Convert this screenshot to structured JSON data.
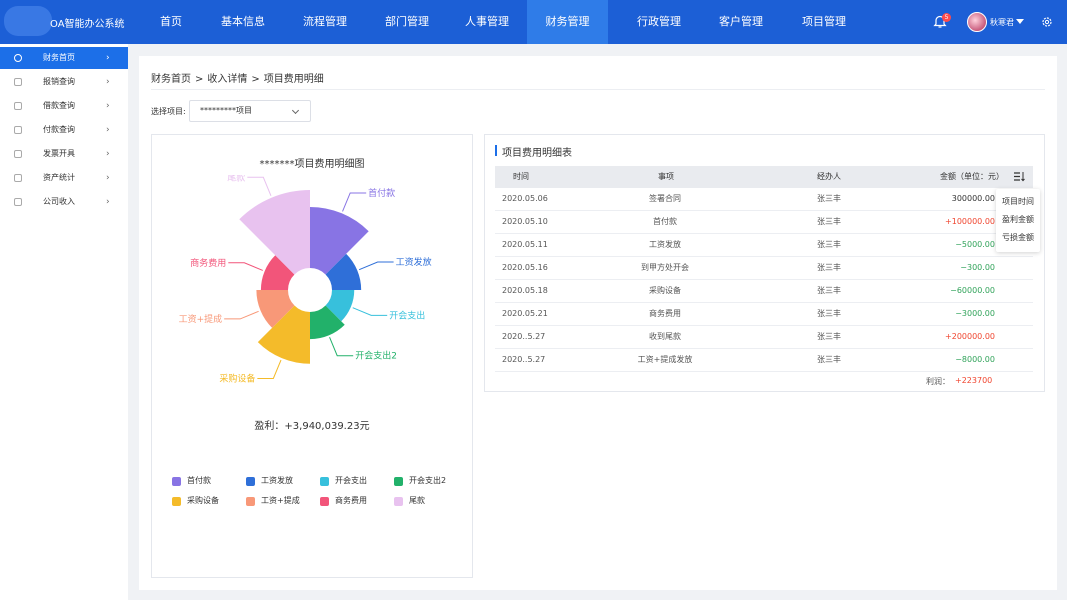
{
  "app": {
    "title": "OA智能办公系统"
  },
  "nav": [
    {
      "label": "首页"
    },
    {
      "label": "基本信息"
    },
    {
      "label": "流程管理"
    },
    {
      "label": "部门管理"
    },
    {
      "label": "人事管理"
    },
    {
      "label": "财务管理",
      "active": true
    },
    {
      "label": "行政管理"
    },
    {
      "label": "客户管理"
    },
    {
      "label": "项目管理"
    }
  ],
  "header": {
    "notifications": "5",
    "user_name": "秋寒君"
  },
  "sidebar": {
    "items": [
      {
        "label": "财务首页",
        "icon": "user-icon",
        "active": true
      },
      {
        "label": "报销查询",
        "icon": "list-icon"
      },
      {
        "label": "借款查询",
        "icon": "home-icon"
      },
      {
        "label": "付款查询",
        "icon": "document-icon"
      },
      {
        "label": "发票开具",
        "icon": "gift-icon"
      },
      {
        "label": "资产统计",
        "icon": "clock-icon"
      },
      {
        "label": "公司收入",
        "icon": "gift-icon"
      }
    ]
  },
  "breadcrumb": [
    "财务首页",
    "收入详情",
    "项目费用明细"
  ],
  "breadcrumb_sep": ">",
  "filter": {
    "label": "选择项目:",
    "value": "*********项目"
  },
  "chart_data": {
    "type": "pie",
    "variant": "nightingale-rose",
    "title": "*******项目费用明细图",
    "categories": [
      "首付款",
      "工资发放",
      "开会支出",
      "开会支出2",
      "采购设备",
      "工资+提成",
      "商务费用",
      "尾款"
    ],
    "values": [
      100000,
      5000,
      300,
      3000,
      60000,
      8000,
      3000,
      200000
    ],
    "colors": [
      "#8874e4",
      "#2f6fd8",
      "#37c0dc",
      "#22b16a",
      "#f4bb2a",
      "#f89878",
      "#f2557a",
      "#e8c2ef"
    ],
    "legend_position": "bottom"
  },
  "profit_text": "盈利：+3,940,039.23元",
  "table": {
    "title": "项目费用明细表",
    "columns": [
      "时间",
      "事项",
      "经办人",
      "金额（单位：元）"
    ],
    "rows": [
      {
        "date": "2020.05.06",
        "item": "签署合同",
        "handler": "张三丰",
        "amount": "300000.00",
        "kind": "base"
      },
      {
        "date": "2020.05.10",
        "item": "首付款",
        "handler": "张三丰",
        "amount": "+100000.00",
        "kind": "pos"
      },
      {
        "date": "2020.05.11",
        "item": "工资发放",
        "handler": "张三丰",
        "amount": "−5000.00",
        "kind": "neg"
      },
      {
        "date": "2020.05.16",
        "item": "到甲方处开会",
        "handler": "张三丰",
        "amount": "−300.00",
        "kind": "neg"
      },
      {
        "date": "2020.05.18",
        "item": "采购设备",
        "handler": "张三丰",
        "amount": "−60000.00",
        "kind": "neg"
      },
      {
        "date": "2020.05.21",
        "item": "商务费用",
        "handler": "张三丰",
        "amount": "−3000.00",
        "kind": "neg"
      },
      {
        "date": "2020..5.27",
        "item": "收到尾款",
        "handler": "张三丰",
        "amount": "+200000.00",
        "kind": "pos"
      },
      {
        "date": "2020..5.27",
        "item": "工资+提成发放",
        "handler": "张三丰",
        "amount": "−8000.00",
        "kind": "neg"
      }
    ],
    "total_label": "利润：",
    "total_value": "+223700"
  },
  "sort_menu": [
    "项目时间",
    "盈利金额",
    "亏损金额"
  ]
}
